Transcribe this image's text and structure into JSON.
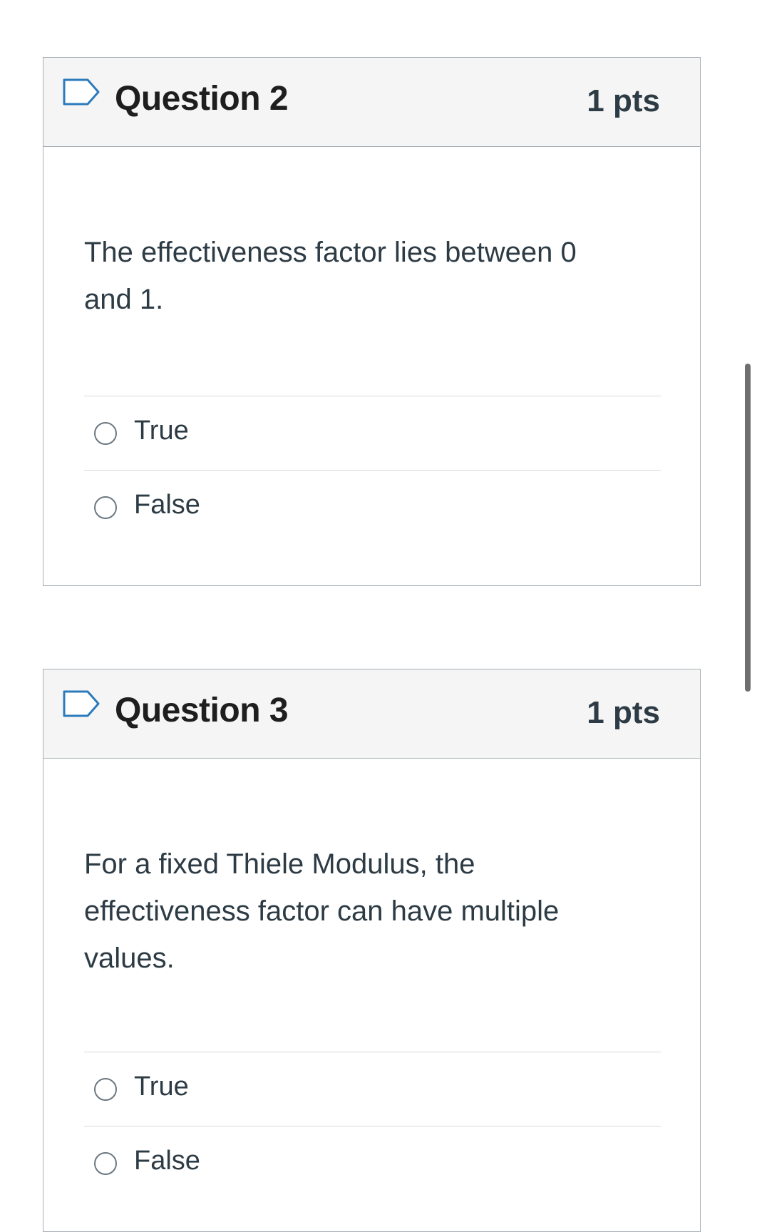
{
  "questions": [
    {
      "title": "Question 2",
      "points": "1 pts",
      "text": "The effectiveness factor lies between 0 and 1.",
      "options": [
        "True",
        "False"
      ]
    },
    {
      "title": "Question 3",
      "points": "1 pts",
      "text": "For a fixed Thiele Modulus, the effectiveness factor can have multiple values.",
      "options": [
        "True",
        "False"
      ]
    }
  ],
  "icons": {
    "flag": "flag-outline-icon"
  },
  "colors": {
    "header_bg": "#f5f5f5",
    "border": "#a7afb5",
    "flag": "#2b7abc",
    "text": "#2d3b45"
  }
}
